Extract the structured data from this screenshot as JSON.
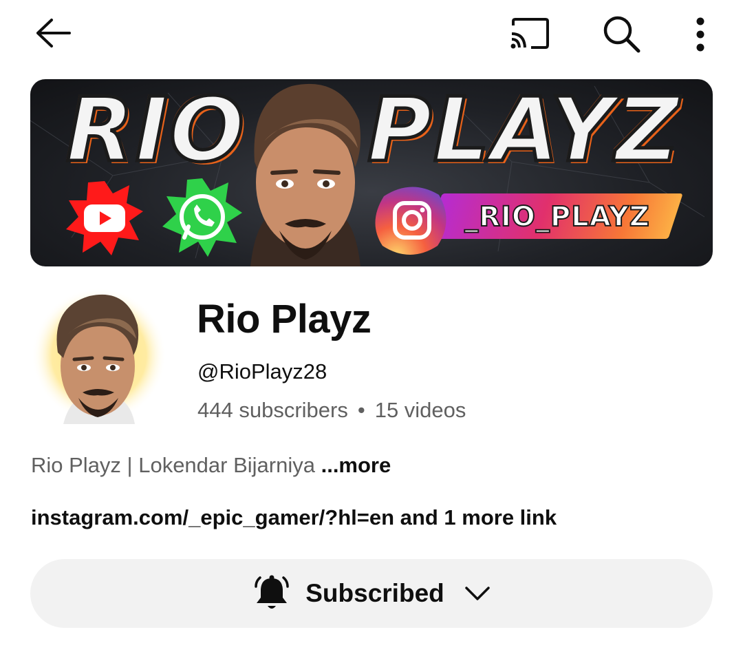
{
  "topbar": {
    "back_icon": "arrow-left-icon",
    "cast_icon": "cast-icon",
    "search_icon": "search-icon",
    "more_icon": "more-vertical-icon"
  },
  "banner": {
    "title_left": "RIO",
    "title_right": "PLAYZ",
    "social_handle": "_RIO_PLAYZ",
    "colors": {
      "youtube": "#ff0000",
      "whatsapp": "#25d366",
      "accent_outline": "#e8621a"
    }
  },
  "channel": {
    "name": "Rio Playz",
    "handle": "@RioPlayz28",
    "subscribers": "444 subscribers",
    "separator": "•",
    "videos": "15 videos",
    "description": "Rio Playz | Lokendar Bijarniya ",
    "description_more": "...more",
    "links_text": "instagram.com/_epic_gamer/?hl=en and 1 more link"
  },
  "subscribe": {
    "label": "Subscribed",
    "bell_icon": "bell-ringing-icon",
    "chevron_icon": "chevron-down-icon",
    "button_color": "#f2f2f2"
  }
}
